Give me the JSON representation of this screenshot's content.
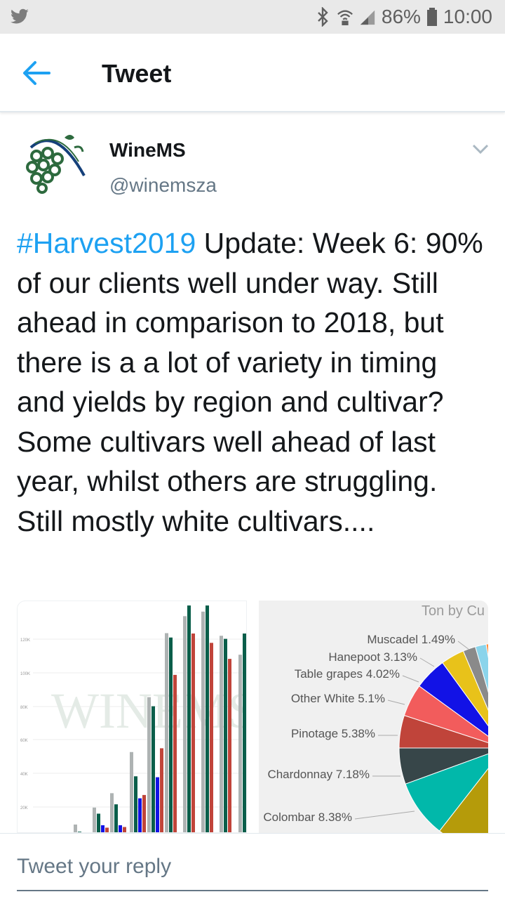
{
  "status_bar": {
    "battery": "86%",
    "time": "10:00",
    "icons": [
      "twitter-bird-icon",
      "bluetooth-icon",
      "wifi-icon",
      "signal-icon",
      "battery-icon"
    ]
  },
  "header": {
    "title": "Tweet",
    "back_icon": "arrow-left-icon"
  },
  "tweet": {
    "author_name": "WineMS",
    "author_handle": "@winemsza",
    "hashtag": "#Harvest2019",
    "text": " Update: Week 6: 90% of our clients well under way. Still ahead in comparison to 2018, but there is a a lot of variety in timing and yields by region and cultivar? Some cultivars well ahead of last year, whilst others are struggling. Still mostly white cultivars....",
    "menu_icon": "chevron-down-icon"
  },
  "media": {
    "bar_chart": {
      "y_ticks": [
        "120K",
        "100K",
        "80K",
        "60K",
        "40K",
        "20K"
      ],
      "watermark": "WINEMS",
      "colors": [
        "#aeb3b3",
        "#0a5e4a",
        "#c0443a",
        "#1212e6"
      ]
    },
    "pie_chart": {
      "title": "Ton by Cu",
      "slices": [
        {
          "label": "Muscadel 1.49%",
          "color": "#7a5c9a"
        },
        {
          "label": "Hanepoot 3.13%",
          "color": "#8a8a8a"
        },
        {
          "label": "Table grapes 4.02%",
          "color": "#e8c21a"
        },
        {
          "label": "Other White 5.1%",
          "color": "#1212e6"
        },
        {
          "label": "Pinotage 5.38%",
          "color": "#f25c5c"
        },
        {
          "label": "Chardonnay 7.18%",
          "color": "#374649"
        },
        {
          "label": "Colombar 8.38%",
          "color": "#01b8aa"
        }
      ]
    }
  },
  "reply": {
    "placeholder": "Tweet your reply"
  }
}
